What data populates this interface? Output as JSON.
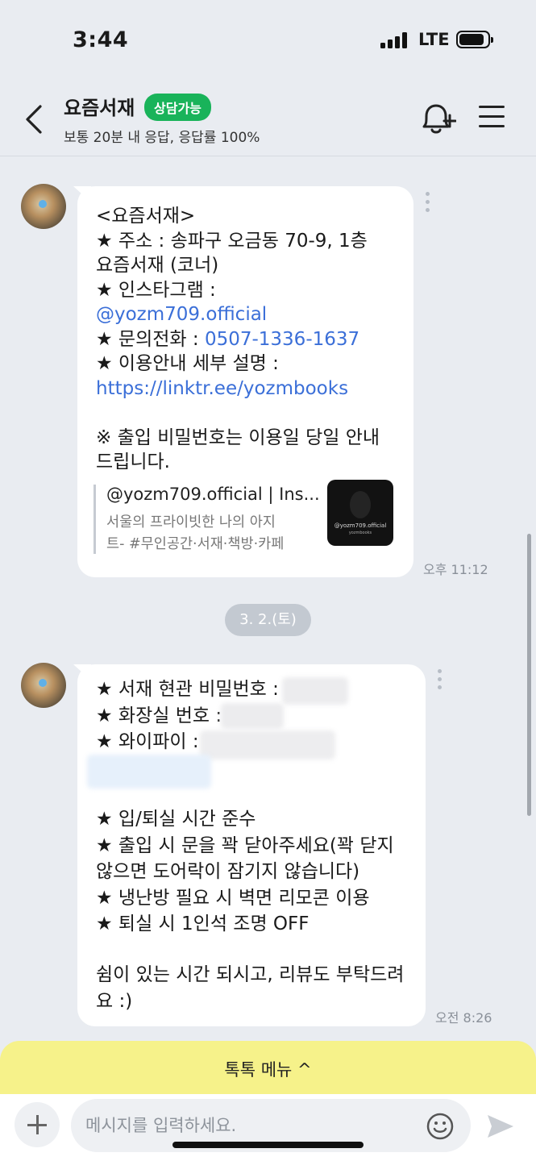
{
  "status_bar": {
    "time": "3:44",
    "network": "LTE"
  },
  "header": {
    "title": "요즘서재",
    "badge": "상담가능",
    "subtitle": "보통 20분 내 응답, 응답률 100%"
  },
  "messages": [
    {
      "lines": [
        "<요즘서재>",
        "★ 주소 : 송파구 오금동 70-9, 1층",
        "요즘서재 (코너)",
        "★ 인스타그램 :",
        "@yozm709.official",
        "★ 문의전화 : ",
        "0507-1336-1637",
        "★ 이용안내 세부 설명 :",
        "https://linktr.ee/yozmbooks",
        "※ 출입 비밀번호는 이용일 당일 안내",
        "드립니다."
      ],
      "preview": {
        "title": "@yozm709.official | Ins...",
        "desc_line1": "서울의 프라이빗한 나의 아지",
        "desc_line2": "트- #무인공간·서재·책방·카페",
        "thumb_handle": "@yozm709.official",
        "thumb_sub": "yozmbooks"
      },
      "time": "오후 11:12"
    },
    {
      "lines": [
        "★ 서재 현관 비밀번호 :",
        "★ 화장실 번호 :",
        "★ 와이파이 :",
        "★ 입/퇴실 시간 준수",
        "★ 출입 시 문을 꽉 닫아주세요(꽉 닫지",
        "않으면 도어락이 잠기지 않습니다)",
        "★ 냉난방 필요 시 벽면 리모콘 이용",
        "★ 퇴실 시 1인석 조명 OFF",
        "쉼이 있는 시간 되시고, 리뷰도 부탁드려",
        "요 :)"
      ],
      "time": "오전 8:26"
    }
  ],
  "date_divider": "3. 2.(토)",
  "talk_menu": {
    "label": "톡톡 메뉴 ^"
  },
  "input": {
    "placeholder": "메시지를 입력하세요."
  },
  "colors": {
    "background": "#e9ecf1",
    "badge": "#19b35a",
    "link": "#3b6fd8",
    "talk_menu": "#f6f28a"
  },
  "icons": [
    "back-icon",
    "bell-plus-icon",
    "hamburger-icon",
    "kebab-icon",
    "plus-icon",
    "emoji-icon",
    "send-icon"
  ]
}
